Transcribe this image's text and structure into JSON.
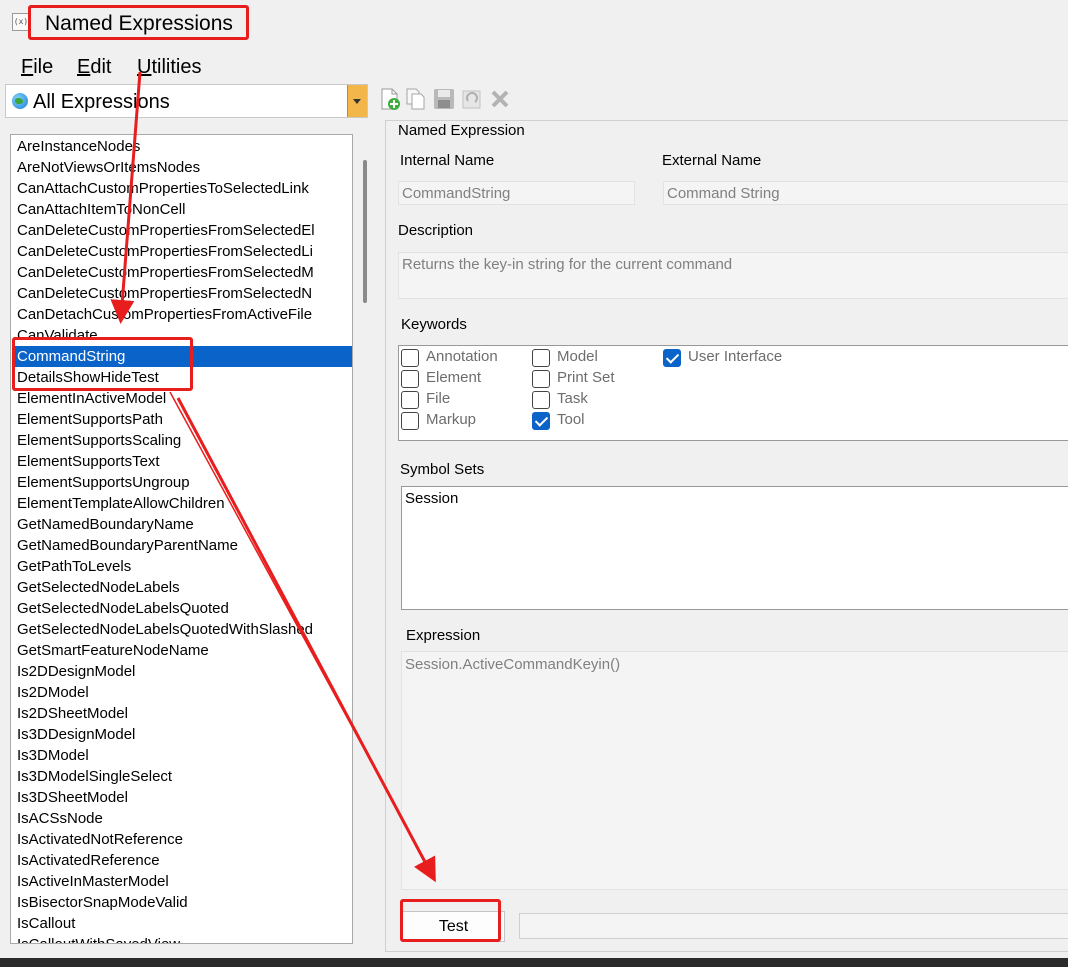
{
  "window": {
    "title": "Named Expressions",
    "app_icon": "expression-icon"
  },
  "menu": {
    "items": [
      {
        "label": "File",
        "accel": "F",
        "rest": "ile"
      },
      {
        "label": "Edit",
        "accel": "E",
        "rest": "dit"
      },
      {
        "label": "Utilities",
        "accel": "U",
        "rest": "tilities"
      }
    ]
  },
  "filter": {
    "selected": "All Expressions",
    "icon": "globe-icon"
  },
  "toolbar": {
    "icons": [
      "new-expression-icon",
      "copy-icon",
      "save-icon",
      "refresh-icon",
      "delete-icon"
    ]
  },
  "expressions": {
    "items": [
      "AreInstanceNodes",
      "AreNotViewsOrItemsNodes",
      "CanAttachCustomPropertiesToSelectedLink",
      "CanAttachItemToNonCell",
      "CanDeleteCustomPropertiesFromSelectedEl",
      "CanDeleteCustomPropertiesFromSelectedLi",
      "CanDeleteCustomPropertiesFromSelectedM",
      "CanDeleteCustomPropertiesFromSelectedN",
      "CanDetachCustomPropertiesFromActiveFile",
      "CanValidate",
      "CommandString",
      "DetailsShowHideTest",
      "ElementInActiveModel",
      "ElementSupportsPath",
      "ElementSupportsScaling",
      "ElementSupportsText",
      "ElementSupportsUngroup",
      "ElementTemplateAllowChildren",
      "GetNamedBoundaryName",
      "GetNamedBoundaryParentName",
      "GetPathToLevels",
      "GetSelectedNodeLabels",
      "GetSelectedNodeLabelsQuoted",
      "GetSelectedNodeLabelsQuotedWithSlashed",
      "GetSmartFeatureNodeName",
      "Is2DDesignModel",
      "Is2DModel",
      "Is2DSheetModel",
      "Is3DDesignModel",
      "Is3DModel",
      "Is3DModelSingleSelect",
      "Is3DSheetModel",
      "IsACSsNode",
      "IsActivatedNotReference",
      "IsActivatedReference",
      "IsActiveInMasterModel",
      "IsBisectorSnapModeValid",
      "IsCallout",
      "IsCalloutWithSavedView"
    ],
    "selected_index": 10
  },
  "details": {
    "group_title": "Named Expression",
    "internal_name_label": "Internal Name",
    "internal_name_value": "CommandString",
    "external_name_label": "External Name",
    "external_name_value": "Command String",
    "description_label": "Description",
    "description_value": "Returns the key-in string for the current command",
    "keywords_label": "Keywords",
    "keywords": [
      {
        "label": "Annotation",
        "checked": false
      },
      {
        "label": "Element",
        "checked": false
      },
      {
        "label": "File",
        "checked": false
      },
      {
        "label": "Markup",
        "checked": false
      },
      {
        "label": "Model",
        "checked": false
      },
      {
        "label": "Print Set",
        "checked": false
      },
      {
        "label": "Task",
        "checked": false
      },
      {
        "label": "Tool",
        "checked": true
      },
      {
        "label": "User Interface",
        "checked": true
      }
    ],
    "symbol_sets_label": "Symbol Sets",
    "symbol_sets": [
      "Session"
    ],
    "expression_label": "Expression",
    "expression_value": "Session.ActiveCommandKeyin()",
    "test_button": "Test",
    "test_result": ""
  },
  "annotation_color": "#e81d1d",
  "selection_color": "#0a63c9"
}
